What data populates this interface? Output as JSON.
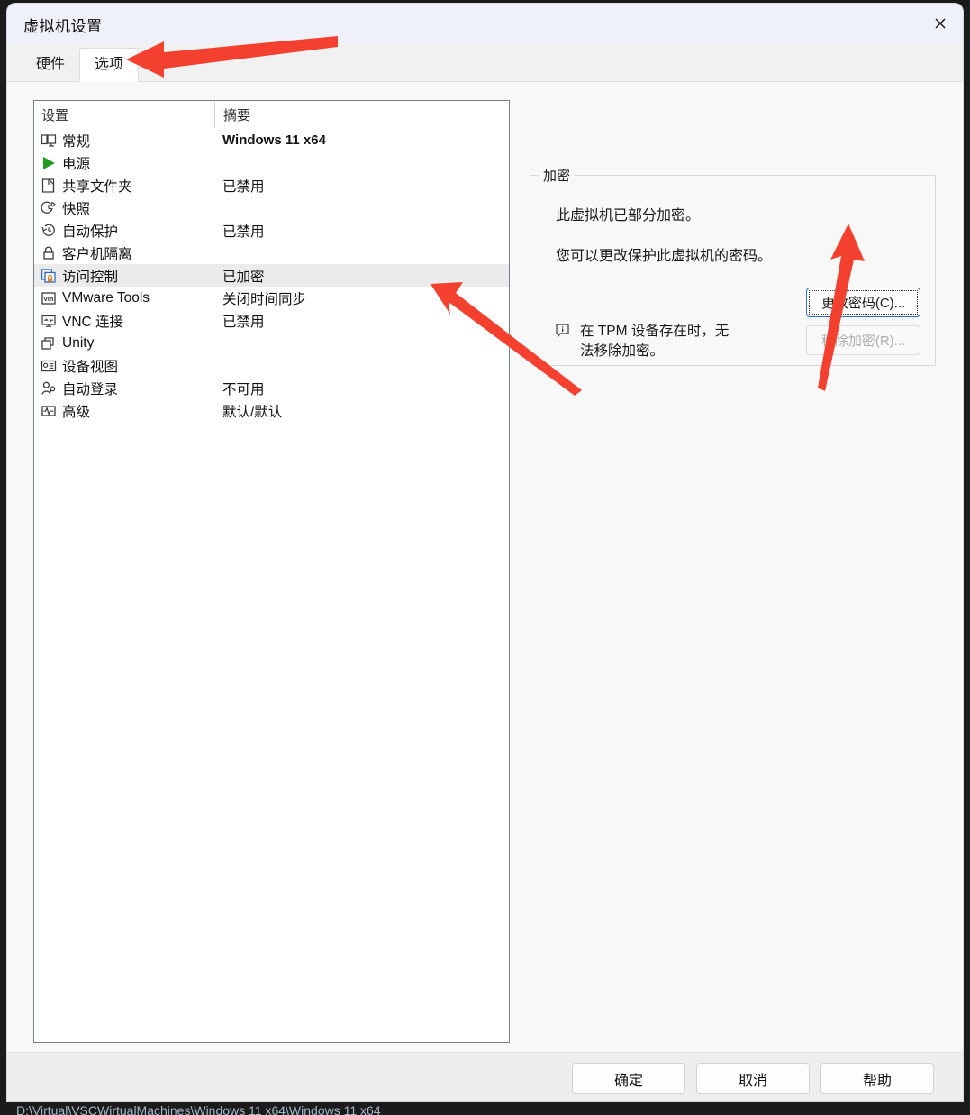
{
  "window": {
    "title": "虚拟机设置",
    "close_icon": "close-icon"
  },
  "tabs": [
    {
      "label": "硬件",
      "active": false
    },
    {
      "label": "选项",
      "active": true
    }
  ],
  "list": {
    "headers": {
      "settings": "设置",
      "summary": "摘要"
    },
    "rows": [
      {
        "icon": "monitor-icon",
        "label": "常规",
        "summary": "Windows 11 x64",
        "bold": true,
        "selected": false
      },
      {
        "icon": "play-icon",
        "label": "电源",
        "summary": "",
        "bold": false,
        "selected": false
      },
      {
        "icon": "shared-folder-icon",
        "label": "共享文件夹",
        "summary": "已禁用",
        "bold": false,
        "selected": false
      },
      {
        "icon": "snapshot-icon",
        "label": "快照",
        "summary": "",
        "bold": false,
        "selected": false
      },
      {
        "icon": "autoprotect-icon",
        "label": "自动保护",
        "summary": "已禁用",
        "bold": false,
        "selected": false
      },
      {
        "icon": "lock-icon",
        "label": "客户机隔离",
        "summary": "",
        "bold": false,
        "selected": false
      },
      {
        "icon": "access-control-icon",
        "label": "访问控制",
        "summary": "已加密",
        "bold": false,
        "selected": true
      },
      {
        "icon": "vmware-tools-icon",
        "label": "VMware Tools",
        "summary": "关闭时间同步",
        "bold": false,
        "selected": false
      },
      {
        "icon": "vnc-icon",
        "label": "VNC 连接",
        "summary": "已禁用",
        "bold": false,
        "selected": false
      },
      {
        "icon": "unity-icon",
        "label": "Unity",
        "summary": "",
        "bold": false,
        "selected": false
      },
      {
        "icon": "device-view-icon",
        "label": "设备视图",
        "summary": "",
        "bold": false,
        "selected": false
      },
      {
        "icon": "autologin-icon",
        "label": "自动登录",
        "summary": "不可用",
        "bold": false,
        "selected": false
      },
      {
        "icon": "advanced-icon",
        "label": "高级",
        "summary": "默认/默认",
        "bold": false,
        "selected": false
      }
    ]
  },
  "encryption": {
    "group_title": "加密",
    "line1": "此虚拟机已部分加密。",
    "line2": "您可以更改保护此虚拟机的密码。",
    "note_icon": "info-icon",
    "note_line1": "在 TPM 设备存在时，无",
    "note_line2": "法移除加密。",
    "change_password_button": "更改密码(C)...",
    "remove_encryption_button": "移除加密(R)..."
  },
  "footer": {
    "ok": "确定",
    "cancel": "取消",
    "help": "帮助"
  },
  "desktop": {
    "path_text": "D:\\Virtual\\VSCWirtualMachines\\Windows 11 x64\\Windows 11 x64"
  },
  "colors": {
    "titlebar": "#eef1f9",
    "accent_blue": "#2a6fd4",
    "selection": "#ebebeb",
    "arrow_red": "#f4402f",
    "lock_orange": "#e08a2e",
    "play_green": "#1f9b1f"
  }
}
